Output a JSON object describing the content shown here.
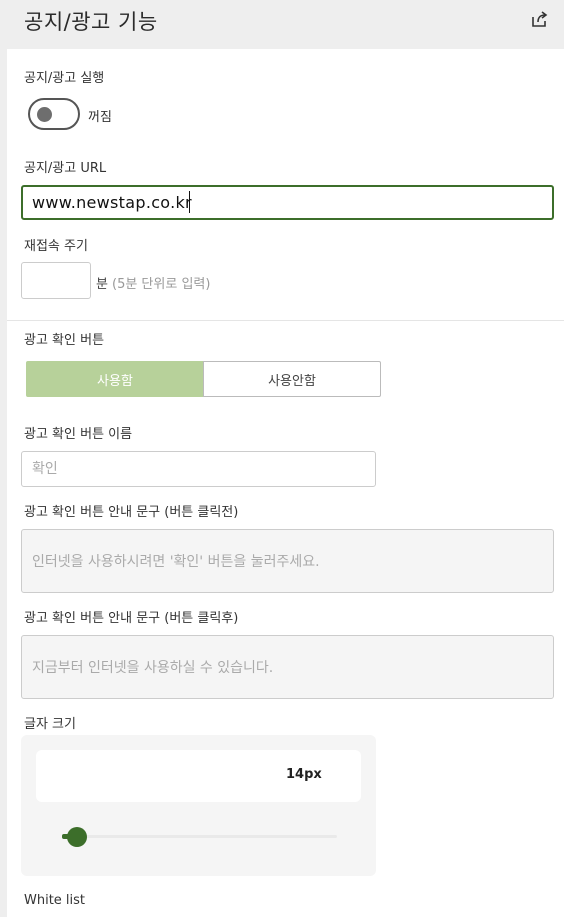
{
  "header": {
    "title": "공지/광고 기능",
    "share_icon": "share-icon"
  },
  "notice": {
    "run_label": "공지/광고 실행",
    "toggle_state": false,
    "toggle_text": "꺼짐",
    "url_label": "공지/광고 URL",
    "url_value": "www.newstap.co.kr",
    "reconnect_label": "재접속 주기",
    "reconnect_value": "",
    "reconnect_unit": "분",
    "reconnect_hint": "(5분 단위로 입력)"
  },
  "ad_button": {
    "label": "광고 확인 버튼",
    "options": [
      "사용함",
      "사용안함"
    ],
    "selected": "사용함",
    "name_label": "광고 확인 버튼 이름",
    "name_placeholder": "확인",
    "guide_before_label": "광고 확인 버튼 안내 문구 (버튼 클릭전)",
    "guide_before_placeholder": "인터넷을 사용하시려면 '확인' 버튼을 눌러주세요.",
    "guide_after_label": "광고 확인 버튼 안내 문구 (버튼 클릭후)",
    "guide_after_placeholder": "지금부터 인터넷을 사용하실 수 있습니다."
  },
  "font_size": {
    "label": "글자 크기",
    "value_text": "14px",
    "slider_fraction": 0.05
  },
  "whitelist": {
    "label": "White list"
  },
  "colors": {
    "accent": "#3c6e2a",
    "selected_segment": "#b7d19a",
    "background": "#eeeeee"
  }
}
